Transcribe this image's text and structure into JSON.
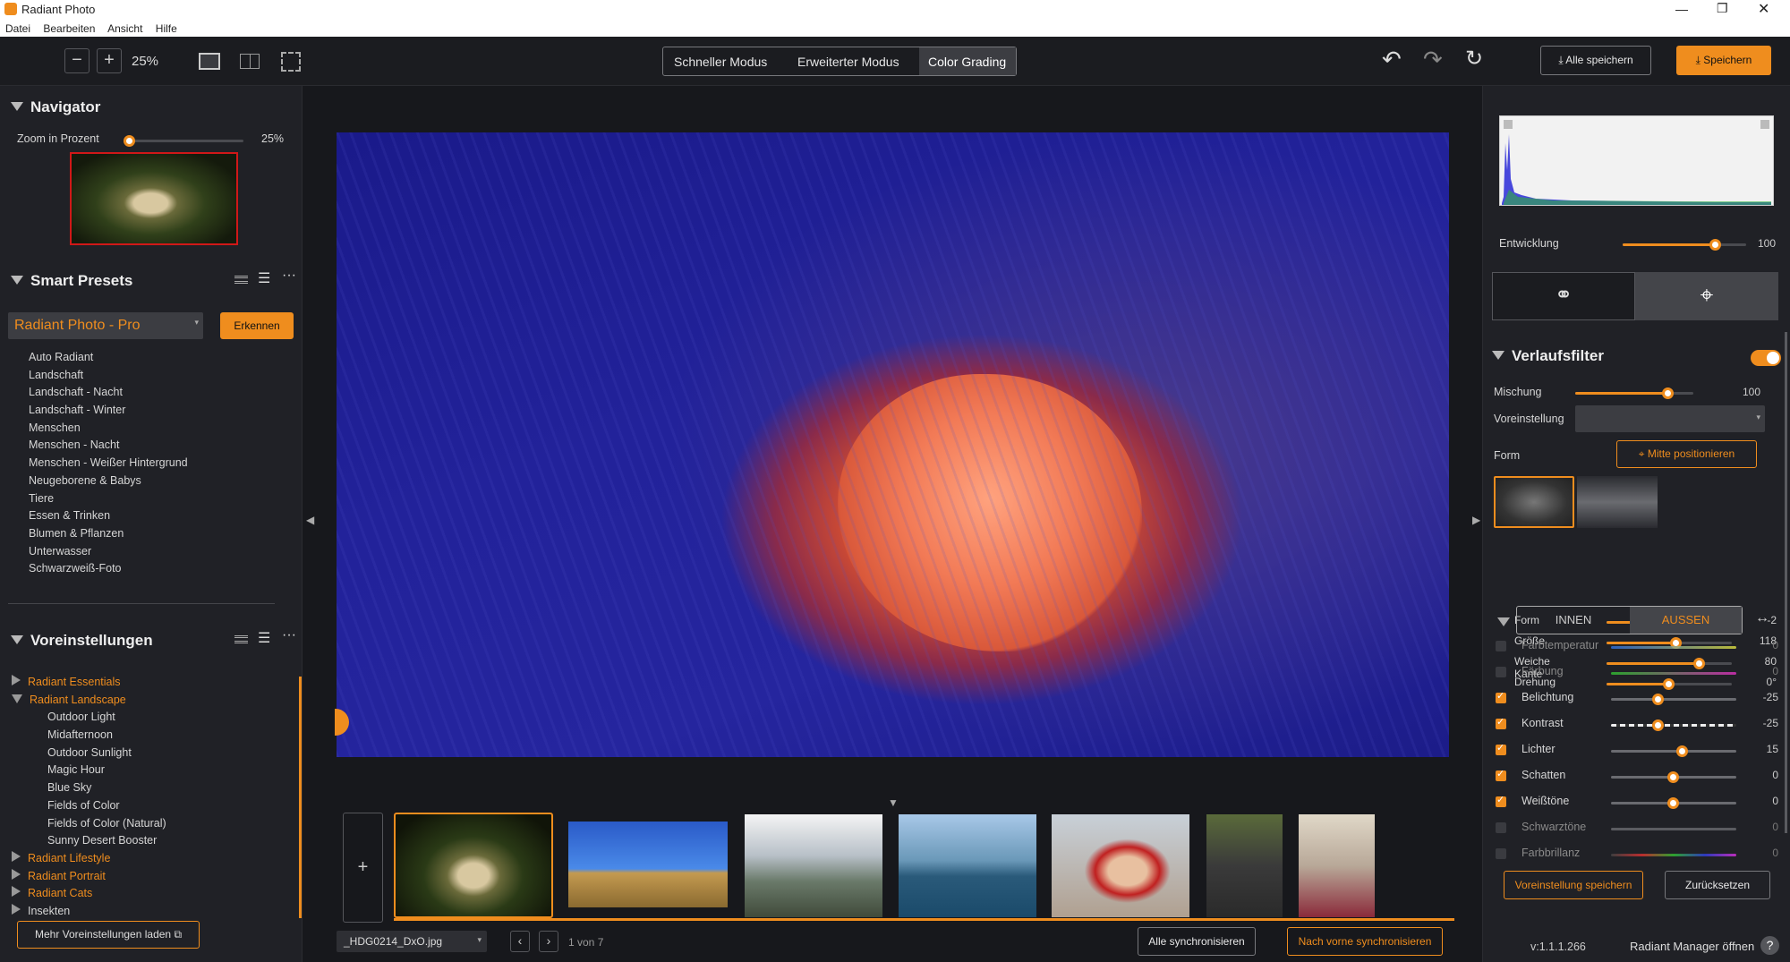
{
  "app": {
    "title": "Radiant Photo"
  },
  "menu": [
    "Datei",
    "Bearbeiten",
    "Ansicht",
    "Hilfe"
  ],
  "toolbar": {
    "zoom": "25%",
    "modes": [
      "Schneller Modus",
      "Erweiterter Modus",
      "Color Grading"
    ],
    "save_all": "Alle speichern",
    "save": "Speichern"
  },
  "navigator": {
    "title": "Navigator",
    "zoom_label": "Zoom in Prozent",
    "zoom_value": "25%",
    "zoom_level": 0.0
  },
  "smart_presets": {
    "title": "Smart Presets",
    "selected": "Radiant Photo - Pro",
    "detect": "Erkennen",
    "items": [
      "Auto Radiant",
      "Landschaft",
      "Landschaft - Nacht",
      "Landschaft - Winter",
      "Menschen",
      "Menschen - Nacht",
      "Menschen - Weißer Hintergrund",
      "Neugeborene & Babys",
      "Tiere",
      "Essen & Trinken",
      "Blumen & Pflanzen",
      "Unterwasser",
      "Schwarzweiß-Foto"
    ]
  },
  "presets": {
    "title": "Voreinstellungen",
    "groups": [
      {
        "name": "Radiant Essentials",
        "open": false
      },
      {
        "name": "Radiant Landscape",
        "open": true,
        "items": [
          "Outdoor Light",
          "Midafternoon",
          "Outdoor Sunlight",
          "Magic Hour",
          "Blue Sky",
          "Fields of Color",
          "Fields of Color (Natural)",
          "Sunny Desert Booster"
        ]
      },
      {
        "name": "Radiant Lifestyle",
        "open": false
      },
      {
        "name": "Radiant Portrait",
        "open": false
      },
      {
        "name": "Radiant Cats",
        "open": false
      },
      {
        "name": "Insekten",
        "open": false,
        "muted": true
      }
    ],
    "more": "Mehr Voreinstellungen laden"
  },
  "filmstrip": {
    "filename": "_HDG0214_DxO.jpg",
    "page": "1 von 7",
    "sync_all": "Alle synchronisieren",
    "sync_forward": "Nach vorne synchronisieren"
  },
  "right": {
    "development": {
      "label": "Entwicklung",
      "value": "100",
      "level": 1.0
    },
    "filter": {
      "title": "Verlaufsfilter",
      "enabled": true,
      "mix": {
        "label": "Mischung",
        "value": "100",
        "level": 1.0
      },
      "preset_label": "Voreinstellung",
      "shape_label": "Form",
      "center_btn": "Mitte positionieren",
      "params": [
        {
          "label": "Form",
          "value": "-2",
          "level": 0.49
        },
        {
          "label": "Größe",
          "value": "118",
          "level": 0.56
        },
        {
          "label": "Weiche Kante",
          "value": "80",
          "level": 0.74
        },
        {
          "label": "Drehung",
          "value": "0°",
          "level": 0.5
        }
      ],
      "tabs": [
        "INNEN",
        "AUSSEN"
      ],
      "active_tab": "AUSSEN",
      "adjust": [
        {
          "label": "Farbtemperatur",
          "value": "0",
          "checked": false,
          "level": 0.5
        },
        {
          "label": "Färbung",
          "value": "0",
          "checked": false,
          "level": 0.5
        },
        {
          "label": "Belichtung",
          "value": "-25",
          "checked": true,
          "level": 0.38
        },
        {
          "label": "Kontrast",
          "value": "-25",
          "checked": true,
          "level": 0.38
        },
        {
          "label": "Lichter",
          "value": "15",
          "checked": true,
          "level": 0.57
        },
        {
          "label": "Schatten",
          "value": "0",
          "checked": true,
          "level": 0.5
        },
        {
          "label": "Weißtöne",
          "value": "0",
          "checked": true,
          "level": 0.5
        },
        {
          "label": "Schwarztöne",
          "value": "0",
          "checked": false,
          "level": 0.5
        },
        {
          "label": "Farbbrillanz",
          "value": "0",
          "checked": false,
          "level": 0.5
        }
      ]
    },
    "save_preset": "Voreinstellung speichern",
    "reset": "Zurücksetzen",
    "version": "v:1.1.1.266",
    "manager": "Radiant Manager öffnen"
  },
  "colors": {
    "accent": "#ef8d1e",
    "bg": "#202126"
  }
}
